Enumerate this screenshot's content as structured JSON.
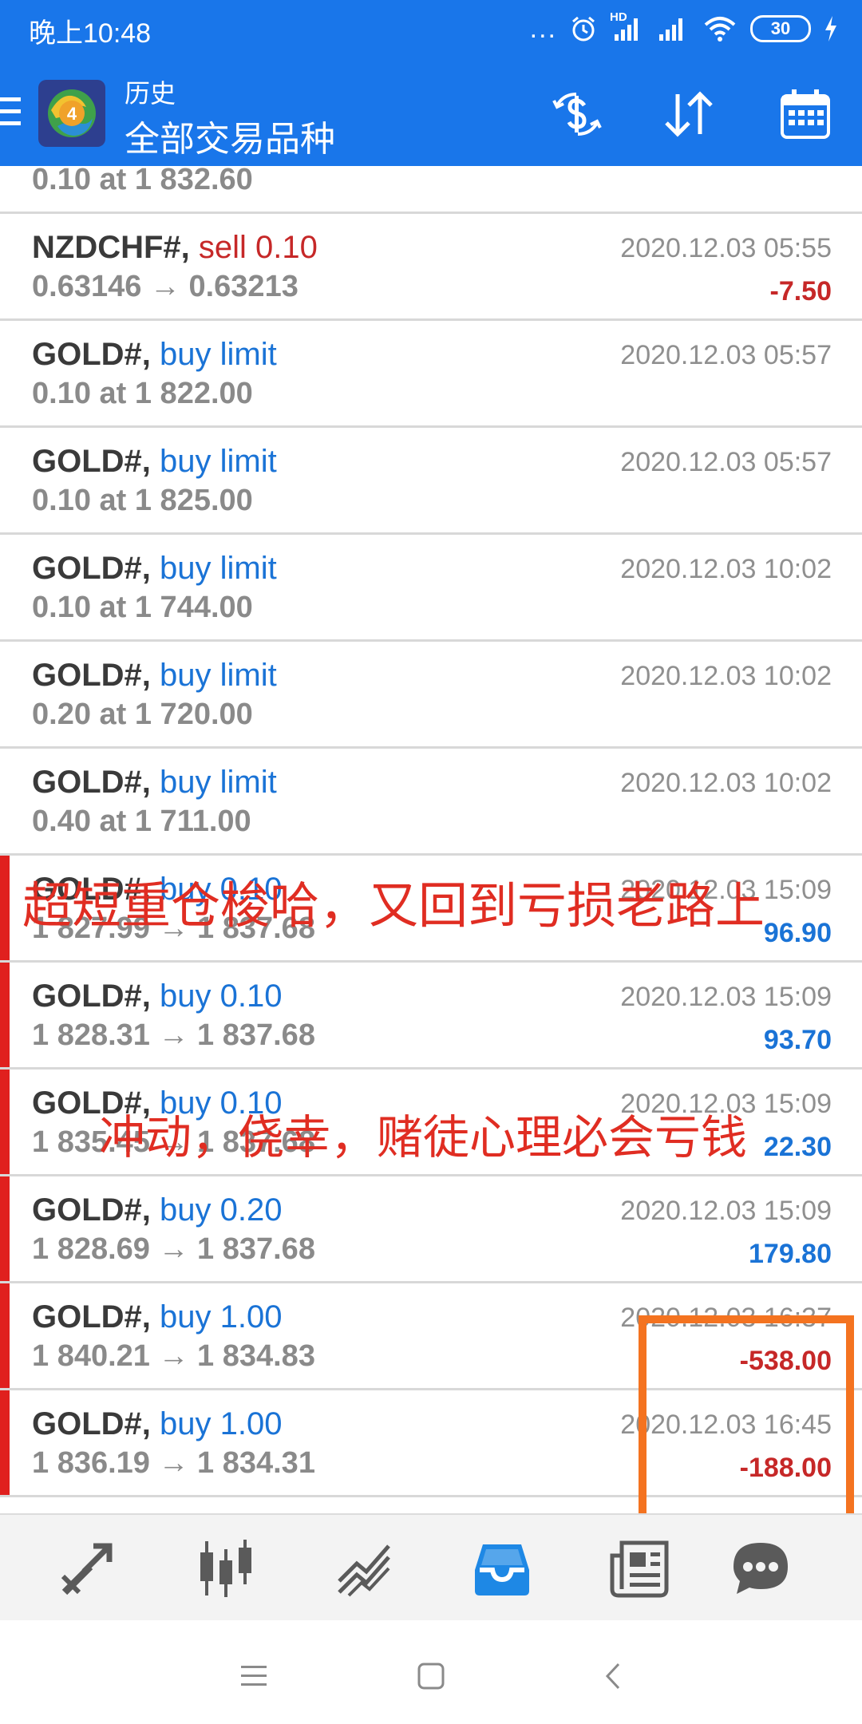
{
  "status_bar": {
    "time": "晚上10:48",
    "dots": "...",
    "network_label": "HD",
    "battery": "30"
  },
  "app_bar": {
    "title": "历史",
    "subtitle": "全部交易品种",
    "logo_badge": "4",
    "icons": [
      "menu-icon",
      "currency-icon",
      "sort-icon",
      "calendar-icon"
    ]
  },
  "colors": {
    "header_bg": "#1976ea",
    "buy": "#1a73d6",
    "sell": "#c62828",
    "marker": "#e0201e",
    "highlight": "#f47320"
  },
  "trades": [
    {
      "symbol": "",
      "type": "",
      "details": "0.10 at 1 832.60",
      "time": "",
      "profit": "",
      "marked": false
    },
    {
      "symbol": "NZDCHF#,",
      "type": "sell 0.10",
      "details": "0.63146 → 0.63213",
      "time": "2020.12.03 05:55",
      "profit": "-7.50",
      "marked": false
    },
    {
      "symbol": "GOLD#,",
      "type": "buy limit",
      "details": "0.10 at 1 822.00",
      "time": "2020.12.03 05:57",
      "profit": "",
      "marked": false
    },
    {
      "symbol": "GOLD#,",
      "type": "buy limit",
      "details": "0.10 at 1 825.00",
      "time": "2020.12.03 05:57",
      "profit": "",
      "marked": false
    },
    {
      "symbol": "GOLD#,",
      "type": "buy limit",
      "details": "0.10 at 1 744.00",
      "time": "2020.12.03 10:02",
      "profit": "",
      "marked": false
    },
    {
      "symbol": "GOLD#,",
      "type": "buy limit",
      "details": "0.20 at 1 720.00",
      "time": "2020.12.03 10:02",
      "profit": "",
      "marked": false
    },
    {
      "symbol": "GOLD#,",
      "type": "buy limit",
      "details": "0.40 at 1 711.00",
      "time": "2020.12.03 10:02",
      "profit": "",
      "marked": false
    },
    {
      "symbol": "GOLD#,",
      "type": "buy 0.10",
      "details": "1 827.99 → 1 837.68",
      "time": "2020.12.03 15:09",
      "profit": "96.90",
      "marked": true
    },
    {
      "symbol": "GOLD#,",
      "type": "buy 0.10",
      "details": "1 828.31 → 1 837.68",
      "time": "2020.12.03 15:09",
      "profit": "93.70",
      "marked": true
    },
    {
      "symbol": "GOLD#,",
      "type": "buy 0.10",
      "details": "1 835.45 → 1 837.68",
      "time": "2020.12.03 15:09",
      "profit": "22.30",
      "marked": true
    },
    {
      "symbol": "GOLD#,",
      "type": "buy 0.20",
      "details": "1 828.69 → 1 837.68",
      "time": "2020.12.03 15:09",
      "profit": "179.80",
      "marked": true
    },
    {
      "symbol": "GOLD#,",
      "type": "buy 1.00",
      "details": "1 840.21 → 1 834.83",
      "time": "2020.12.03 16:37",
      "profit": "-538.00",
      "marked": true
    },
    {
      "symbol": "GOLD#,",
      "type": "buy 1.00",
      "details": "1 836.19 → 1 834.31",
      "time": "2020.12.03 16:45",
      "profit": "-188.00",
      "marked": true
    }
  ],
  "annotations": [
    "超短重仓梭哈，又回到亏损老路上",
    "冲动，侥幸，赌徒心理必会亏钱"
  ],
  "bottom_nav": [
    "trade-icon",
    "chart-candles-icon",
    "analytics-icon",
    "history-inbox-icon",
    "news-icon",
    "chat-icon"
  ],
  "active_tab": "history-inbox-icon"
}
